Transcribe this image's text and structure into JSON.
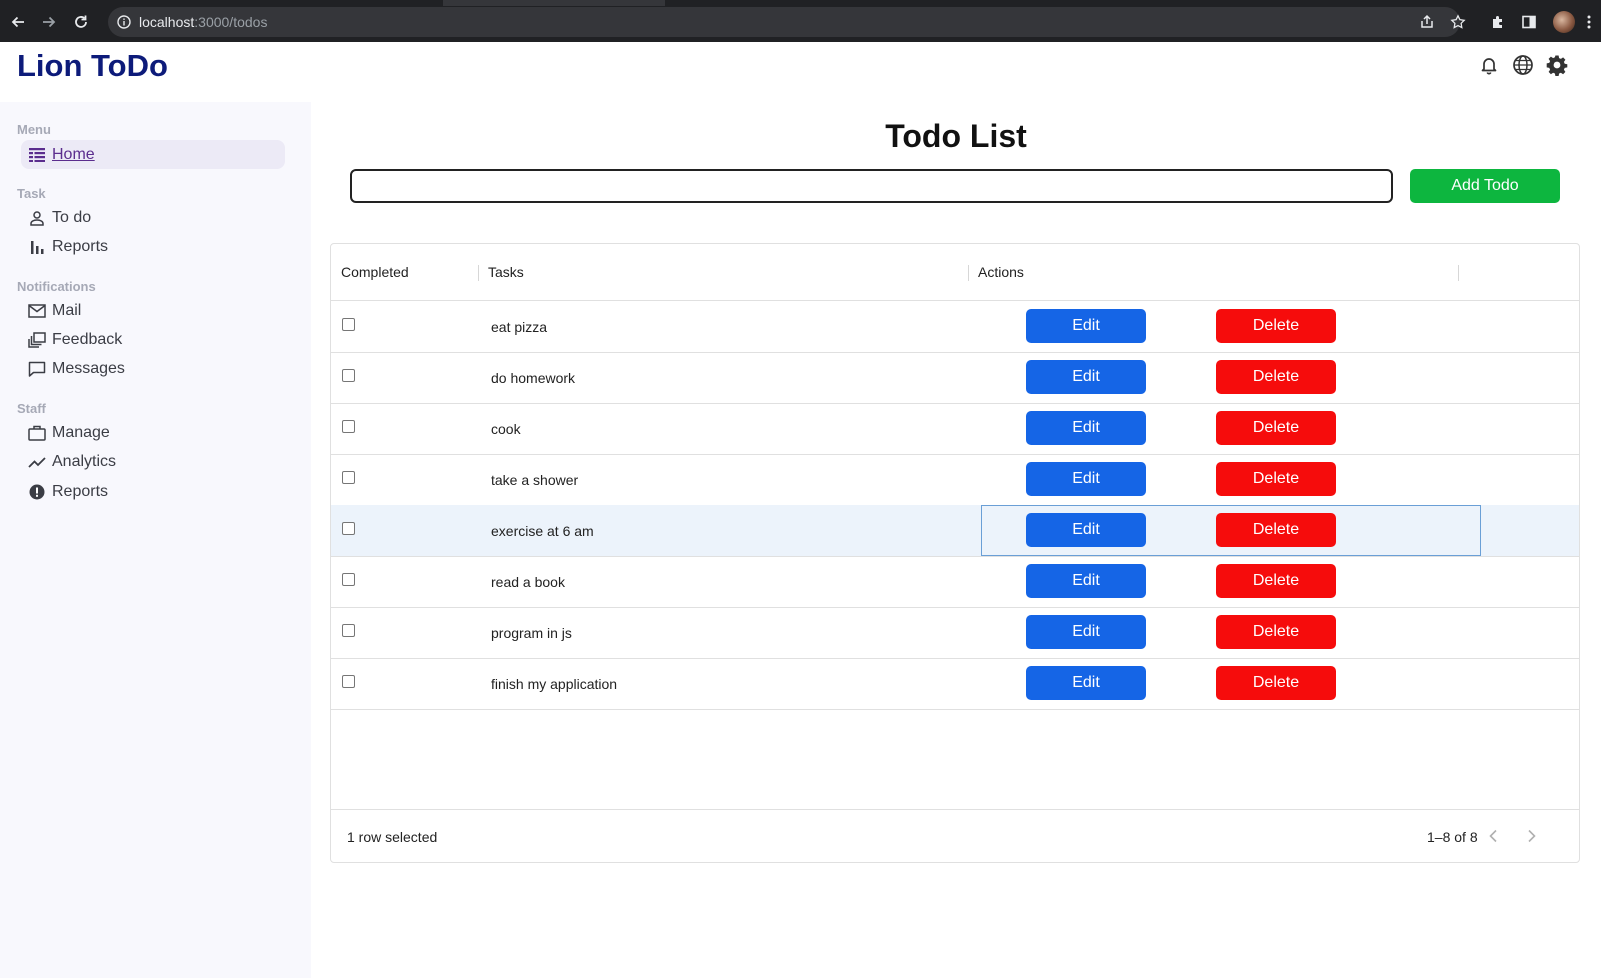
{
  "browser": {
    "url_host": "localhost",
    "url_path": ":3000/todos"
  },
  "app": {
    "title": "Lion ToDo"
  },
  "header_icons": [
    "bell-icon",
    "globe-icon",
    "gear-icon"
  ],
  "sidebar": {
    "sections": [
      {
        "title": "Menu",
        "items": [
          {
            "label": "Home",
            "icon": "table-icon",
            "active": true
          }
        ]
      },
      {
        "title": "Task",
        "items": [
          {
            "label": "To do",
            "icon": "person-icon"
          },
          {
            "label": "Reports",
            "icon": "bar-chart-icon"
          }
        ]
      },
      {
        "title": "Notifications",
        "items": [
          {
            "label": "Mail",
            "icon": "mail-icon"
          },
          {
            "label": "Feedback",
            "icon": "feedback-icon"
          },
          {
            "label": "Messages",
            "icon": "chat-icon"
          }
        ]
      },
      {
        "title": "Staff",
        "items": [
          {
            "label": "Manage",
            "icon": "briefcase-icon"
          },
          {
            "label": "Analytics",
            "icon": "trend-icon"
          },
          {
            "label": "Reports",
            "icon": "alert-icon"
          }
        ]
      }
    ]
  },
  "main": {
    "title": "Todo List",
    "input_value": "",
    "add_button": "Add Todo",
    "columns": {
      "completed": "Completed",
      "tasks": "Tasks",
      "actions": "Actions"
    },
    "edit_label": "Edit",
    "delete_label": "Delete",
    "rows": [
      {
        "task": "eat pizza",
        "selected": false
      },
      {
        "task": "do homework",
        "selected": false
      },
      {
        "task": "cook",
        "selected": false
      },
      {
        "task": "take a shower",
        "selected": false
      },
      {
        "task": "exercise at 6 am",
        "selected": true
      },
      {
        "task": "read a book",
        "selected": false
      },
      {
        "task": "program in js",
        "selected": false
      },
      {
        "task": "finish my application",
        "selected": false
      }
    ],
    "footer": {
      "selection": "1 row selected",
      "range": "1–8 of 8"
    }
  },
  "colors": {
    "logo": "#0d1b7a",
    "add_button": "#0db63f",
    "edit_button": "#1565e6",
    "delete_button": "#f60c0c",
    "sidebar_bg": "#f8f8fd"
  }
}
